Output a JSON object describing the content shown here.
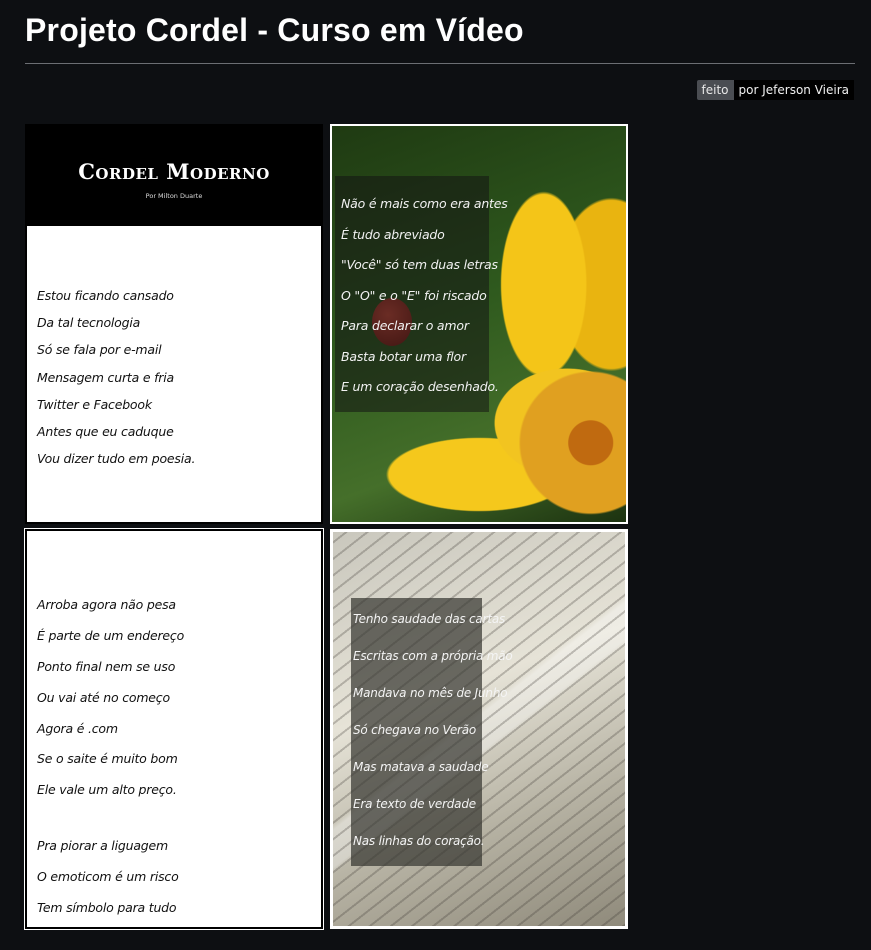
{
  "header": {
    "title": "Projeto Cordel - Curso em Vídeo",
    "credit_made": "feito",
    "credit_by": "por Jeferson Vieira"
  },
  "panels": [
    {
      "banner_title": "Cordel Moderno",
      "banner_subtitle": "Por Milton Duarte",
      "lines": [
        "Estou ficando cansado",
        "Da tal tecnologia",
        "Só se fala por e-mail",
        "Mensagem curta e fria",
        "Twitter e Facebook",
        "Antes que eu caduque",
        "Vou dizer tudo em poesia."
      ]
    },
    {
      "lines": [
        "Não é mais como era antes",
        "É tudo abreviado",
        "\"Você\" só tem duas letras",
        "O \"O\" e o \"E\" foi riscado",
        "Para declarar o amor",
        "Basta botar uma flor",
        "E um coração desenhado."
      ]
    },
    {
      "lines": [
        "Arroba agora não pesa",
        "É parte de um endereço",
        "Ponto final nem se uso",
        "Ou vai até no começo",
        "Agora é .com",
        "Se o saite é muito bom",
        "Ele vale um alto preço.",
        "Pra piorar a liguagem",
        "O emoticom é um risco",
        "Tem símbolo para tudo"
      ]
    },
    {
      "lines": [
        "Tenho saudade das cartas",
        "Escritas com a própria mão",
        "Mandava no mês de Junho",
        "Só chegava no Verão",
        "Mas matava a saudade",
        "Era texto de verdade",
        "Nas linhas do coração."
      ]
    }
  ]
}
